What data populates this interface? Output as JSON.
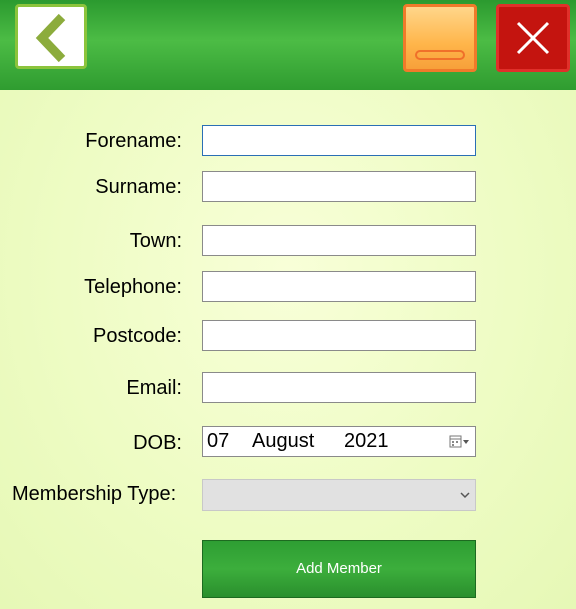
{
  "toolbar": {
    "back_icon": "chevron-left-icon",
    "minimize_icon": "minimize-icon",
    "close_icon": "close-icon",
    "colors": {
      "bar": "#2b9a2f",
      "minimize": "#ffb54a",
      "close": "#c4140f"
    }
  },
  "form": {
    "forename_label": "Forename:",
    "forename_value": "",
    "surname_label": "Surname:",
    "surname_value": "",
    "town_label": "Town:",
    "town_value": "",
    "telephone_label": "Telephone:",
    "telephone_value": "",
    "postcode_label": "Postcode:",
    "postcode_value": "",
    "email_label": "Email:",
    "email_value": "",
    "dob_label": "DOB:",
    "dob_day": "07",
    "dob_month": "August",
    "dob_year": "2021",
    "membership_label": "Membership Type:",
    "membership_value": "",
    "add_button": "Add Member"
  }
}
